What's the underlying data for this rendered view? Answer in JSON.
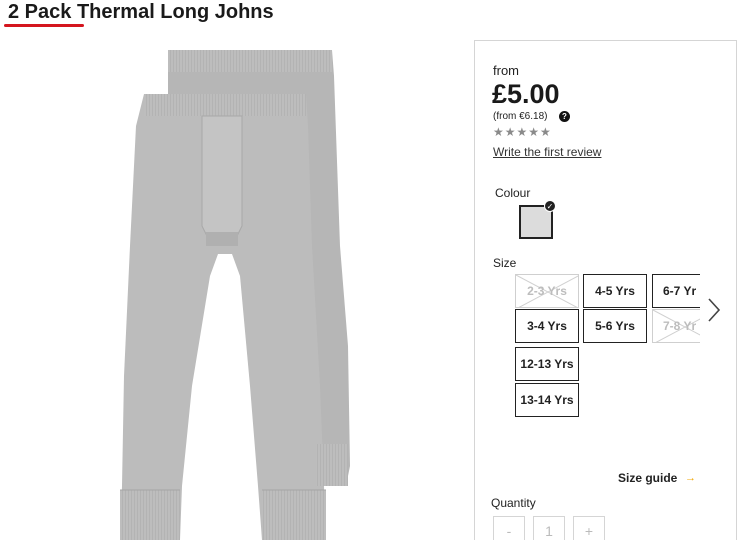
{
  "product": {
    "title": "2 Pack Thermal Long Johns",
    "image_icon": "thermal-long-johns-image"
  },
  "price": {
    "from_label": "from",
    "value": "£5.00",
    "alt_value": "(from €6.18)",
    "help_glyph": "?"
  },
  "rating": {
    "stars": "★★★★★",
    "review_link": "Write the first review"
  },
  "colour": {
    "label": "Colour",
    "selected_hex": "#dcdcdc"
  },
  "size": {
    "label": "Size",
    "options": [
      {
        "label": "2-3 Yrs",
        "available": false
      },
      {
        "label": "4-5 Yrs",
        "available": true
      },
      {
        "label": "6-7 Yr",
        "available": true
      },
      {
        "label": "3-4 Yrs",
        "available": true
      },
      {
        "label": "5-6 Yrs",
        "available": true
      },
      {
        "label": "7-8 Yr",
        "available": false
      },
      {
        "label": "12-13 Yrs",
        "available": true
      },
      {
        "label": "13-14 Yrs",
        "available": true
      }
    ]
  },
  "size_guide": {
    "label": "Size guide",
    "arrow": "→"
  },
  "quantity": {
    "label": "Quantity",
    "minus": "-",
    "value": "1",
    "plus": "+"
  },
  "colors": {
    "accent_red": "#d4151e",
    "size_guide_arrow": "#f0a500"
  }
}
